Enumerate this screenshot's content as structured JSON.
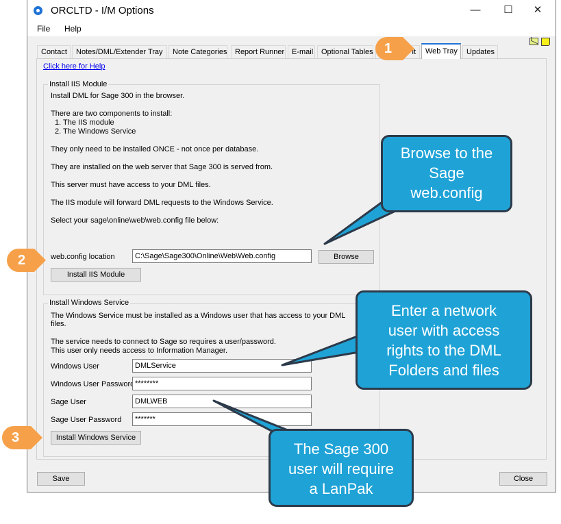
{
  "window": {
    "title": "ORCLTD - I/M Options",
    "controls": {
      "minimize": "—",
      "maximize": "☐",
      "close": "✕"
    }
  },
  "menu": {
    "file": "File",
    "help": "Help"
  },
  "tabs": [
    {
      "label": "Contact"
    },
    {
      "label": "Notes/DML/Extender Tray"
    },
    {
      "label": "Note Categories"
    },
    {
      "label": "Report Runner"
    },
    {
      "label": "E-mail"
    },
    {
      "label": "Optional Tables"
    },
    {
      "label": "it"
    },
    {
      "label": "Web Tray",
      "active": true
    },
    {
      "label": "Updates"
    }
  ],
  "help_link": "Click here for Help",
  "iis": {
    "legend": "Install IIS Module",
    "lines": [
      "Install DML for Sage 300 in the browser.",
      "There are two components to install:",
      "1. The IIS module",
      "2. The Windows Service",
      "They only need to be installed ONCE - not once per database.",
      "They are installed on the web server that Sage 300 is served from.",
      "This server must have access to your DML files.",
      "The IIS module will forward DML requests to the Windows Service.",
      "Select your sage\\online\\web\\web.config file below:"
    ],
    "webconfig_label": "web.config location",
    "webconfig_value": "C:\\Sage\\Sage300\\Online\\Web\\Web.config",
    "browse_button": "Browse",
    "install_button": "Install IIS Module"
  },
  "service": {
    "legend": "Install Windows Service",
    "lines": [
      "The Windows Service must be installed as a Windows user that has access to your DML",
      "files.",
      "The service needs to connect to Sage so requires a user/password.",
      "This user only needs access to Information Manager."
    ],
    "windows_user_label": "Windows User",
    "windows_user_value": "DMLService",
    "windows_password_label": "Windows User Password",
    "windows_password_value": "********",
    "sage_user_label": "Sage User",
    "sage_user_value": "DMLWEB",
    "sage_password_label": "Sage User Password",
    "sage_password_value": "*******",
    "install_button": "Install Windows Service"
  },
  "footer": {
    "save": "Save",
    "close": "Close"
  },
  "callouts": {
    "browse_lines": [
      "Browse to the",
      "Sage",
      "web.config"
    ],
    "network_lines": [
      "Enter a network",
      "user with access",
      "rights to the DML",
      "Folders and files"
    ],
    "sage_lines": [
      "The Sage 300",
      "user will require",
      "a LanPak"
    ],
    "badges": [
      "1",
      "2",
      "3"
    ]
  },
  "colors": {
    "accent": "#1e73d6",
    "bubble": "#1fa3d7",
    "badge": "#f6a14a",
    "bubble_border": "#2c3a4a"
  }
}
